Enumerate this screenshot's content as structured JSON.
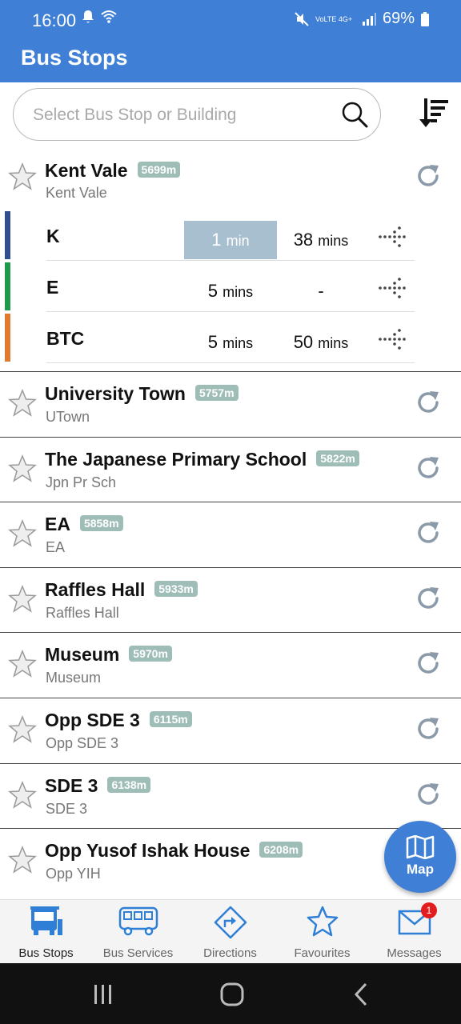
{
  "status_bar": {
    "time": "16:00",
    "battery": "69%",
    "network_labels": "VoLTE 4G+"
  },
  "app": {
    "title": "Bus Stops"
  },
  "search": {
    "placeholder": "Select Bus Stop or Building"
  },
  "colors": {
    "primary": "#3f7fd6",
    "badge": "#9fbdb7",
    "highlight": "#a8bfcf"
  },
  "expanded_stop": {
    "name": "Kent Vale",
    "distance": "5699m",
    "code": "Kent Vale",
    "services": [
      {
        "name": "K",
        "color": "#2f4f8f",
        "next": "1",
        "next_unit": "min",
        "next_highlight": true,
        "second": "38",
        "second_unit": "mins"
      },
      {
        "name": "E",
        "color": "#1f9a4a",
        "next": "5",
        "next_unit": "mins",
        "next_highlight": false,
        "second": "-",
        "second_unit": ""
      },
      {
        "name": "BTC",
        "color": "#e07a30",
        "next": "5",
        "next_unit": "mins",
        "next_highlight": false,
        "second": "50",
        "second_unit": "mins"
      }
    ]
  },
  "stops": [
    {
      "name": "University Town",
      "distance": "5757m",
      "code": "UTown"
    },
    {
      "name": "The Japanese Primary School",
      "distance": "5822m",
      "code": "Jpn Pr Sch"
    },
    {
      "name": "EA",
      "distance": "5858m",
      "code": "EA"
    },
    {
      "name": "Raffles Hall",
      "distance": "5933m",
      "code": "Raffles Hall"
    },
    {
      "name": "Museum",
      "distance": "5970m",
      "code": "Museum"
    },
    {
      "name": "Opp SDE 3",
      "distance": "6115m",
      "code": "Opp SDE 3"
    },
    {
      "name": "SDE 3",
      "distance": "6138m",
      "code": "SDE 3"
    },
    {
      "name": "Opp Yusof Ishak House",
      "distance": "6208m",
      "code": "Opp YIH"
    }
  ],
  "map_button": {
    "label": "Map"
  },
  "bottom_nav": [
    {
      "label": "Bus Stops",
      "icon": "bus-stop-icon",
      "active": true
    },
    {
      "label": "Bus Services",
      "icon": "bus-icon",
      "active": false
    },
    {
      "label": "Directions",
      "icon": "directions-icon",
      "active": false
    },
    {
      "label": "Favourites",
      "icon": "star-icon",
      "active": false
    },
    {
      "label": "Messages",
      "icon": "mail-icon",
      "active": false,
      "badge": "1"
    }
  ]
}
